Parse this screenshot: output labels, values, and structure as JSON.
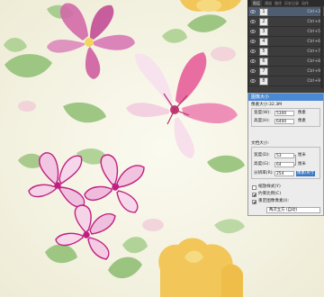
{
  "layers_panel": {
    "tabs": [
      "图层",
      "通道",
      "路径",
      "历史记录",
      "动作"
    ],
    "active_tab": 0,
    "layers": [
      {
        "thumb": "1",
        "shortcut": "Ctrl+3",
        "selected": true
      },
      {
        "thumb": "2",
        "shortcut": "Ctrl+4",
        "selected": false
      },
      {
        "thumb": "3",
        "shortcut": "Ctrl+5",
        "selected": false
      },
      {
        "thumb": "4",
        "shortcut": "Ctrl+6",
        "selected": false
      },
      {
        "thumb": "5",
        "shortcut": "Ctrl+7",
        "selected": false
      },
      {
        "thumb": "6",
        "shortcut": "Ctrl+8",
        "selected": false
      },
      {
        "thumb": "7",
        "shortcut": "Ctrl+9",
        "selected": false
      },
      {
        "thumb": "8",
        "shortcut": "Ctrl+9",
        "selected": false
      }
    ]
  },
  "image_size_dialog": {
    "title": "图像大小",
    "pixel_dimensions": "像素大小:32.3M",
    "width_label": "宽度(W):",
    "width_value": "5300",
    "width_unit": "像素",
    "height_label": "高度(H):",
    "height_value": "6400",
    "height_unit": "像素",
    "doc_size_label": "文档大小:",
    "doc_width_label": "宽度(D):",
    "doc_width_value": "53",
    "doc_width_unit": "厘米",
    "doc_height_label": "高度(G):",
    "doc_height_value": "64",
    "doc_height_unit": "厘米",
    "resolution_label": "分辨率(R):",
    "resolution_value": "254",
    "resolution_unit": "像素/英寸",
    "scale_styles": "缩放样式(Y)",
    "constrain": "约束比例(C)",
    "resample": "重定图像像素(I):",
    "method": "两次立方 (自动)"
  },
  "colors": {
    "canvas_bg": "#f6f4e6",
    "panel_bg": "#3c3c3c",
    "selected_layer": "#4f5d72",
    "dialog_bg": "#ececec",
    "title_bar": "#4a89d4"
  }
}
